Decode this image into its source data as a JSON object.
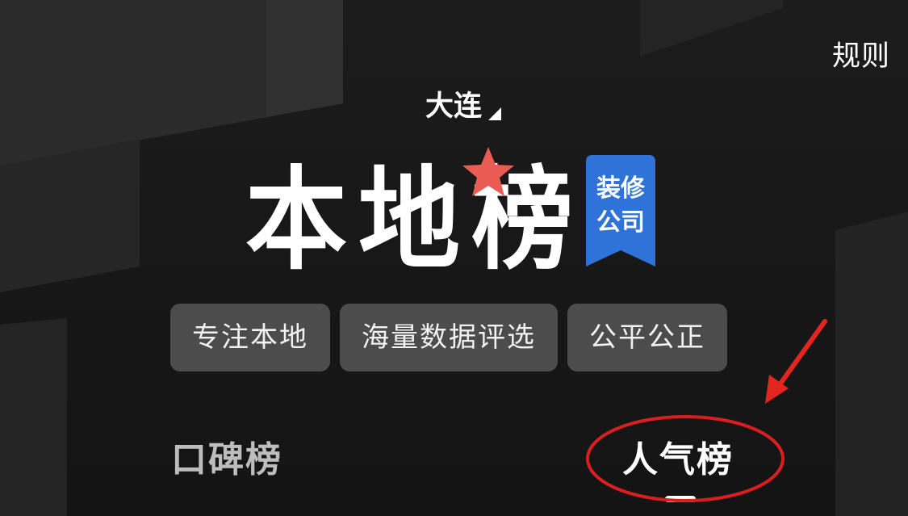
{
  "header": {
    "rules_label": "规则",
    "city": "大连"
  },
  "banner": {
    "title_chars": [
      "本",
      "地",
      "榜"
    ],
    "badge_line1": "装修",
    "badge_line2": "公司"
  },
  "tags": [
    "专注本地",
    "海量数据评选",
    "公平公正"
  ],
  "tabs": [
    {
      "label": "口碑榜",
      "active": false
    },
    {
      "label": "人气榜",
      "active": true
    }
  ],
  "colors": {
    "background": "#171717",
    "star": "#ea5b54",
    "badge": "#2f73d9",
    "chip": "#4c4c4c",
    "annotation": "#d81e1e"
  }
}
